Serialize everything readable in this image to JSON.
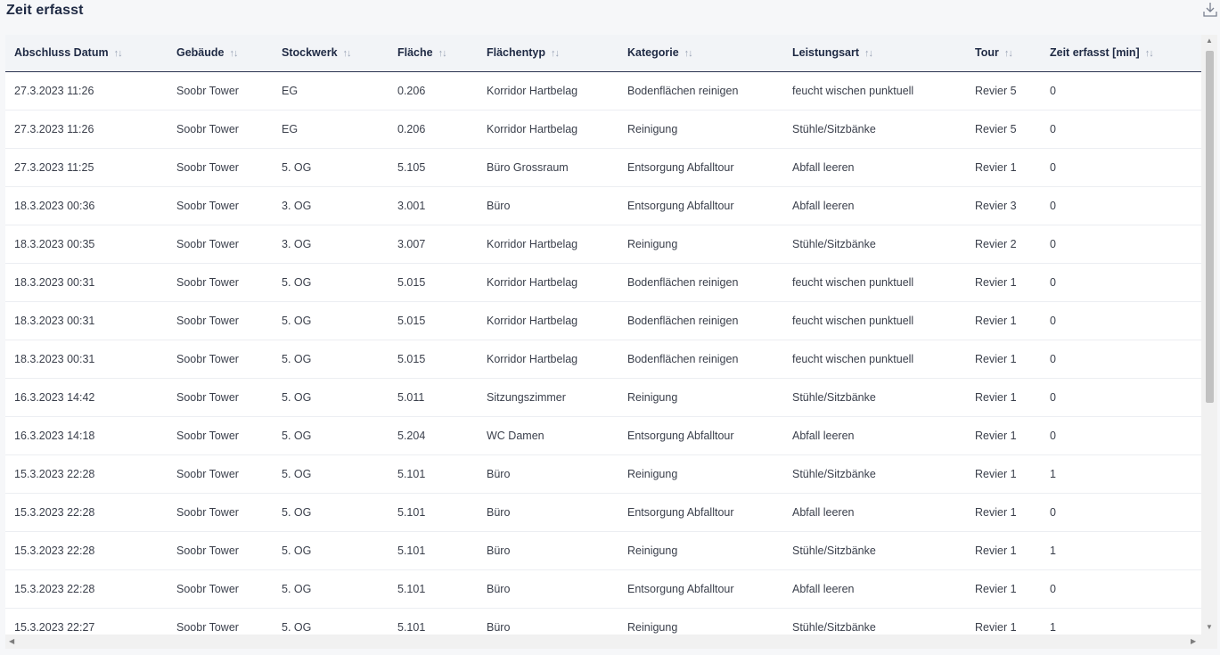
{
  "header": {
    "title": "Zeit erfasst"
  },
  "table": {
    "columns": [
      "Abschluss Datum",
      "Gebäude",
      "Stockwerk",
      "Fläche",
      "Flächentyp",
      "Kategorie",
      "Leistungsart",
      "Tour",
      "Zeit erfasst [min]"
    ],
    "sort_glyph": "↑↓",
    "rows": [
      [
        "27.3.2023 11:26",
        "Soobr Tower",
        "EG",
        "0.206",
        "Korridor Hartbelag",
        "Bodenflächen reinigen",
        "feucht wischen punktuell",
        "Revier 5",
        "0"
      ],
      [
        "27.3.2023 11:26",
        "Soobr Tower",
        "EG",
        "0.206",
        "Korridor Hartbelag",
        "Reinigung",
        "Stühle/Sitzbänke",
        "Revier 5",
        "0"
      ],
      [
        "27.3.2023 11:25",
        "Soobr Tower",
        "5. OG",
        "5.105",
        "Büro Grossraum",
        "Entsorgung Abfalltour",
        "Abfall leeren",
        "Revier 1",
        "0"
      ],
      [
        "18.3.2023 00:36",
        "Soobr Tower",
        "3. OG",
        "3.001",
        "Büro",
        "Entsorgung Abfalltour",
        "Abfall leeren",
        "Revier 3",
        "0"
      ],
      [
        "18.3.2023 00:35",
        "Soobr Tower",
        "3. OG",
        "3.007",
        "Korridor Hartbelag",
        "Reinigung",
        "Stühle/Sitzbänke",
        "Revier 2",
        "0"
      ],
      [
        "18.3.2023 00:31",
        "Soobr Tower",
        "5. OG",
        "5.015",
        "Korridor Hartbelag",
        "Bodenflächen reinigen",
        "feucht wischen punktuell",
        "Revier 1",
        "0"
      ],
      [
        "18.3.2023 00:31",
        "Soobr Tower",
        "5. OG",
        "5.015",
        "Korridor Hartbelag",
        "Bodenflächen reinigen",
        "feucht wischen punktuell",
        "Revier 1",
        "0"
      ],
      [
        "18.3.2023 00:31",
        "Soobr Tower",
        "5. OG",
        "5.015",
        "Korridor Hartbelag",
        "Bodenflächen reinigen",
        "feucht wischen punktuell",
        "Revier 1",
        "0"
      ],
      [
        "16.3.2023 14:42",
        "Soobr Tower",
        "5. OG",
        "5.011",
        "Sitzungszimmer",
        "Reinigung",
        "Stühle/Sitzbänke",
        "Revier 1",
        "0"
      ],
      [
        "16.3.2023 14:18",
        "Soobr Tower",
        "5. OG",
        "5.204",
        "WC Damen",
        "Entsorgung Abfalltour",
        "Abfall leeren",
        "Revier 1",
        "0"
      ],
      [
        "15.3.2023 22:28",
        "Soobr Tower",
        "5. OG",
        "5.101",
        "Büro",
        "Reinigung",
        "Stühle/Sitzbänke",
        "Revier 1",
        "1"
      ],
      [
        "15.3.2023 22:28",
        "Soobr Tower",
        "5. OG",
        "5.101",
        "Büro",
        "Entsorgung Abfalltour",
        "Abfall leeren",
        "Revier 1",
        "0"
      ],
      [
        "15.3.2023 22:28",
        "Soobr Tower",
        "5. OG",
        "5.101",
        "Büro",
        "Reinigung",
        "Stühle/Sitzbänke",
        "Revier 1",
        "1"
      ],
      [
        "15.3.2023 22:28",
        "Soobr Tower",
        "5. OG",
        "5.101",
        "Büro",
        "Entsorgung Abfalltour",
        "Abfall leeren",
        "Revier 1",
        "0"
      ],
      [
        "15.3.2023 22:27",
        "Soobr Tower",
        "5. OG",
        "5.101",
        "Büro",
        "Reinigung",
        "Stühle/Sitzbänke",
        "Revier 1",
        "1"
      ]
    ]
  },
  "icons": {
    "download": "download-icon",
    "sort": "sort-icon",
    "scroll_up": "triangle-up-icon",
    "scroll_down": "triangle-down-icon",
    "scroll_left": "triangle-left-icon",
    "scroll_right": "triangle-right-icon"
  }
}
